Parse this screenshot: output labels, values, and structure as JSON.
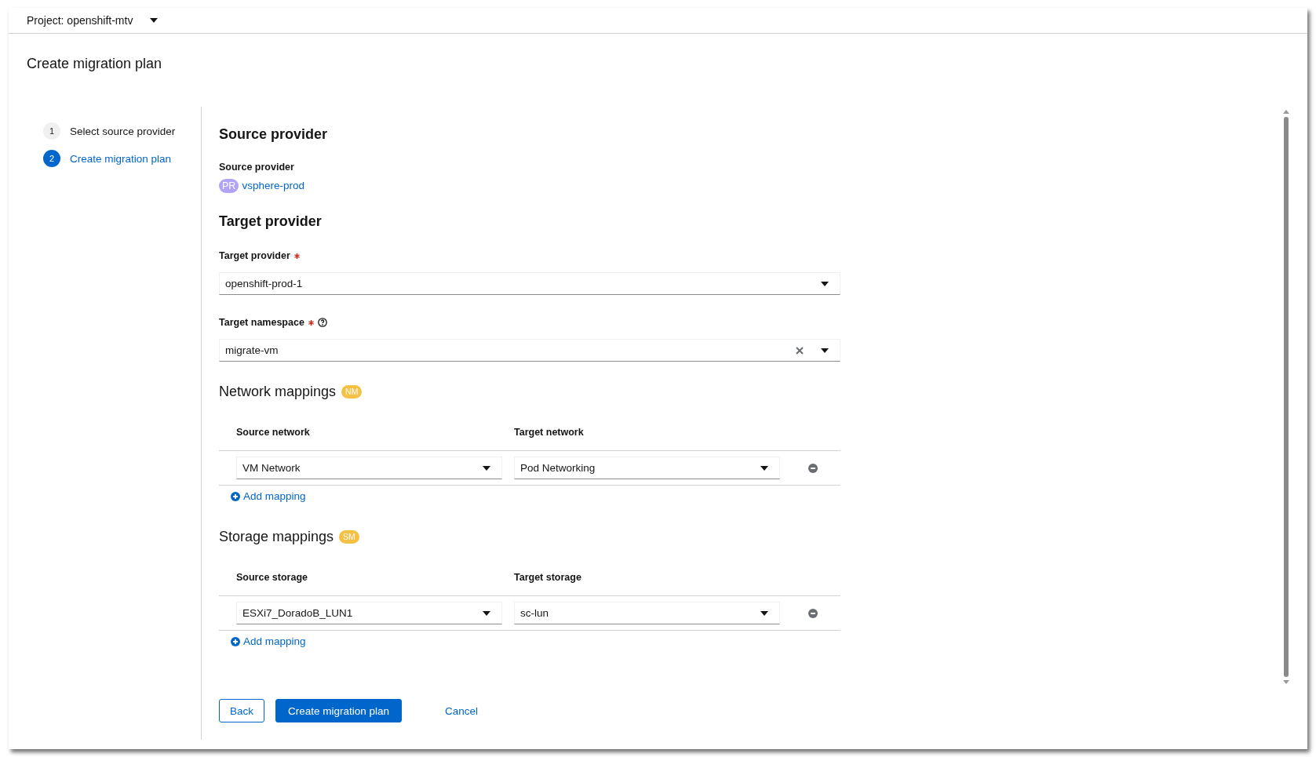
{
  "project_selector": {
    "label": "Project: openshift-mtv"
  },
  "page_title": "Create migration plan",
  "wizard_steps": [
    {
      "number": "1",
      "label": "Select source provider",
      "selected": false
    },
    {
      "number": "2",
      "label": "Create migration plan",
      "selected": true
    }
  ],
  "source_provider": {
    "heading": "Source provider",
    "label": "Source provider",
    "badge": "PR",
    "link": "vsphere-prod"
  },
  "target_provider": {
    "heading": "Target provider",
    "fields": [
      {
        "label": "Target provider",
        "required": true,
        "help": false,
        "value": "openshift-prod-1",
        "clearable": false
      },
      {
        "label": "Target namespace",
        "required": true,
        "help": true,
        "value": "migrate-vm",
        "clearable": true
      }
    ]
  },
  "mappings": [
    {
      "heading": "Network mappings",
      "badge": "NM",
      "columns": [
        "Source network",
        "Target network"
      ],
      "rows": [
        {
          "source": "VM Network",
          "target": "Pod Networking"
        }
      ],
      "add_label": "Add mapping"
    },
    {
      "heading": "Storage mappings",
      "badge": "SM",
      "columns": [
        "Source storage",
        "Target storage"
      ],
      "rows": [
        {
          "source": "ESXi7_DoradoB_LUN1",
          "target": "sc-lun"
        }
      ],
      "add_label": "Add mapping"
    }
  ],
  "buttons": [
    {
      "label": "Back",
      "kind": "secondary"
    },
    {
      "label": "Create migration plan",
      "kind": "primary"
    },
    {
      "label": "Cancel",
      "kind": "link"
    }
  ]
}
